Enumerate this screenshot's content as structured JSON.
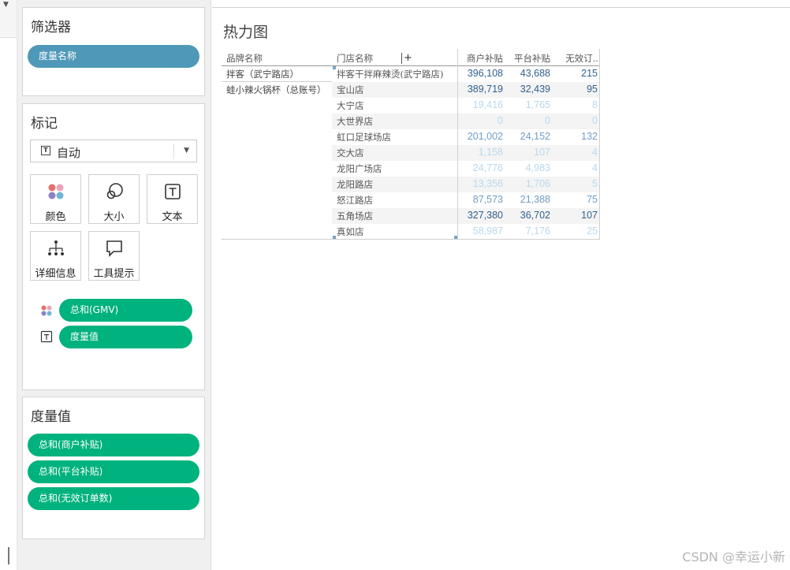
{
  "filters": {
    "title": "筛选器",
    "pill": "度量名称"
  },
  "marks": {
    "title": "标记",
    "mark_type": "自动",
    "buttons": [
      "颜色",
      "大小",
      "文本",
      "详细信息",
      "工具提示"
    ],
    "encodings": [
      {
        "icon": "color-icon",
        "label": "总和(GMV)"
      },
      {
        "icon": "text-icon",
        "label": "度量值"
      }
    ]
  },
  "measure_values": {
    "title": "度量值",
    "pills": [
      "总和(商户补贴)",
      "总和(平台补贴)",
      "总和(无效订单数)"
    ]
  },
  "sheet": {
    "title": "热力图",
    "columns": {
      "brand": "品牌名称",
      "store": "门店名称",
      "merchant_subsidy": "商户补贴",
      "platform_subsidy": "平台补贴",
      "invalid_orders": "无效订.."
    },
    "brands": [
      "拌客（武宁路店）",
      "蛙小辣火锅杯（总账号）"
    ],
    "rows": [
      {
        "store": "拌客干拌麻辣烫(武宁路店)",
        "m": "396,108",
        "p": "43,688",
        "i": "215",
        "level": 3
      },
      {
        "store": "宝山店",
        "m": "389,719",
        "p": "32,439",
        "i": "95",
        "level": 3
      },
      {
        "store": "大宁店",
        "m": "19,416",
        "p": "1,765",
        "i": "8",
        "level": 1
      },
      {
        "store": "大世界店",
        "m": "0",
        "p": "0",
        "i": "0",
        "level": 1
      },
      {
        "store": "虹口足球场店",
        "m": "201,002",
        "p": "24,152",
        "i": "132",
        "level": 2
      },
      {
        "store": "交大店",
        "m": "1,158",
        "p": "107",
        "i": "4",
        "level": 1
      },
      {
        "store": "龙阳广场店",
        "m": "24,776",
        "p": "4,983",
        "i": "4",
        "level": 1
      },
      {
        "store": "龙阳路店",
        "m": "13,356",
        "p": "1,706",
        "i": "5",
        "level": 1
      },
      {
        "store": "怒江路店",
        "m": "87,573",
        "p": "21,388",
        "i": "75",
        "level": 2
      },
      {
        "store": "五角场店",
        "m": "327,380",
        "p": "36,702",
        "i": "107",
        "level": 3
      },
      {
        "store": "真如店",
        "m": "58,987",
        "p": "7,176",
        "i": "25",
        "level": 1
      }
    ]
  },
  "colors": {
    "level1": "#b8d8ec",
    "level2": "#6f9cc4",
    "level3": "#2f5f8f",
    "blue_pill": "#4f98b8",
    "green_pill": "#00b27d"
  },
  "watermark": "CSDN @幸运小新"
}
